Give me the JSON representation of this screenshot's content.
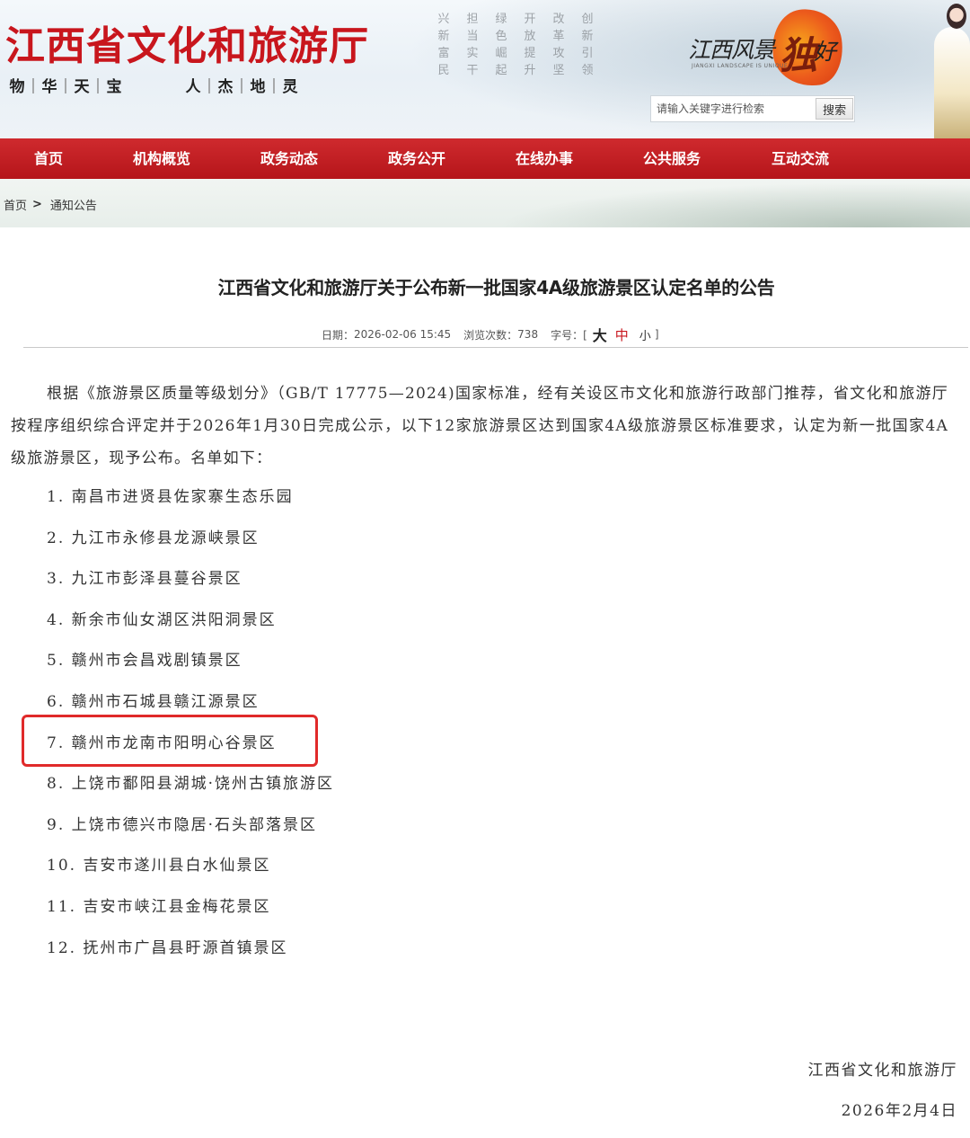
{
  "header": {
    "site_title": "江西省文化和旅游厅",
    "slogan_left": [
      "物",
      "华",
      "天",
      "宝"
    ],
    "slogan_right": [
      "人",
      "杰",
      "地",
      "灵"
    ],
    "poem_chars": [
      [
        "兴",
        "担",
        "绿",
        "开",
        "改",
        "创"
      ],
      [
        "新",
        "当",
        "色",
        "放",
        "革",
        "新"
      ],
      [
        "富",
        "实",
        "崛",
        "提",
        "攻",
        "引"
      ],
      [
        "民",
        "干",
        "起",
        "升",
        "坚",
        "领"
      ]
    ],
    "brand_logo": {
      "text_left": "江西风景",
      "highlight_char": "独",
      "text_right": "好",
      "subtitle": "JIANGXI LANDSCAPE IS UNIQUE"
    },
    "search": {
      "placeholder": "请输入关键字进行检索",
      "button_label": "搜索"
    }
  },
  "nav": {
    "items": [
      {
        "label": "首页"
      },
      {
        "label": "机构概览"
      },
      {
        "label": "政务动态"
      },
      {
        "label": "政务公开"
      },
      {
        "label": "在线办事"
      },
      {
        "label": "公共服务"
      },
      {
        "label": "互动交流"
      }
    ]
  },
  "breadcrumb": {
    "home": "首页",
    "separator": ">",
    "current": "通知公告"
  },
  "article": {
    "title": "江西省文化和旅游厅关于公布新一批国家4A级旅游景区认定名单的公告",
    "meta": {
      "date_label": "日期：",
      "date_value": "2026-02-06 15:45",
      "views_label": "浏览次数：",
      "views_value": "738",
      "font_label": "字号：[",
      "font_large": "大",
      "font_medium": "中",
      "font_small": "小",
      "font_close": "]"
    },
    "body": "根据《旅游景区质量等级划分》（GB/T 17775—2024)国家标准，经有关设区市文化和旅游行政部门推荐，省文化和旅游厅按程序组织综合评定并于2026年1月30日完成公示，以下12家旅游景区达到国家4A级旅游景区标准要求，认定为新一批国家4A级旅游景区，现予公布。名单如下：",
    "list": [
      "1. 南昌市进贤县佐家寨生态乐园",
      "2. 九江市永修县龙源峡景区",
      "3. 九江市彭泽县蔓谷景区",
      "4. 新余市仙女湖区洪阳洞景区",
      "5. 赣州市会昌戏剧镇景区",
      "6. 赣州市石城县赣江源景区",
      "7. 赣州市龙南市阳明心谷景区",
      "8. 上饶市鄱阳县湖城·饶州古镇旅游区",
      "9. 上饶市德兴市隐居·石头部落景区",
      "10. 吉安市遂川县白水仙景区",
      "11. 吉安市峡江县金梅花景区",
      "12. 抚州市广昌县盱源首镇景区"
    ],
    "highlighted_item": 7,
    "signature": {
      "org": "江西省文化和旅游厅",
      "date": "2026年2月4日"
    }
  },
  "colors": {
    "brand_red": "#c8161d",
    "nav_red": "#b5151a",
    "highlight_red": "#e02a2a"
  }
}
